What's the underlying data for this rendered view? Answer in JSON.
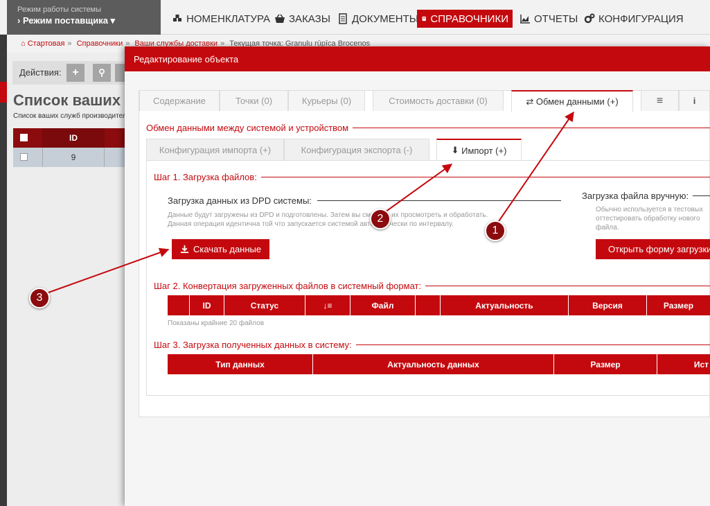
{
  "topbar": {
    "mode_caption": "Режим работы системы",
    "mode_value": "Режим поставщика",
    "nav": [
      {
        "label": "НОМЕНКЛАТУРА",
        "icon": "cubes-icon"
      },
      {
        "label": "ЗАКАЗЫ",
        "icon": "basket-icon"
      },
      {
        "label": "ДОКУМЕНТЫ",
        "icon": "document-icon"
      },
      {
        "label": "СПРАВОЧНИКИ",
        "icon": "book-icon",
        "active": true
      },
      {
        "label": "ОТЧЕТЫ",
        "icon": "chart-icon"
      },
      {
        "label": "КОНФИГУРАЦИЯ",
        "icon": "gears-icon"
      }
    ]
  },
  "breadcrumb": {
    "items": [
      "Стартовая",
      "Справочники",
      "Ваши службы доставки"
    ],
    "current": "Текущая точка: Granulu rūpīca Broceņos"
  },
  "background_page": {
    "actions_label": "Действия:",
    "title": "Список ваших служб доставки",
    "subtitle": "Список ваших служб производителя",
    "table_header_id": "ID",
    "row_id": "9"
  },
  "modal": {
    "title": "Редактирование объекта",
    "tabs": [
      "Содержание",
      "Точки (0)",
      "Курьеры (0)",
      "Стоимость доставки (0)",
      "Обмен данными (+)"
    ],
    "section_title": "Обмен данными между системой и устройством",
    "subtabs": [
      "Конфигурация импорта (+)",
      "Конфигурация экспорта (-)",
      "Импорт (+)"
    ],
    "step1": "Шаг 1. Загрузка файлов:",
    "dpd_title": "Загрузка данных из DPD системы:",
    "dpd_desc_1": "Данные будут загружены из DPD и подготовлены. Затем вы сможете их просмотреть и обработать.",
    "dpd_desc_2": "Данная операция идентична той что запускается системой автоматически по интервалу.",
    "download_button": "Скачать данные",
    "manual_title": "Загрузка файла вручную:",
    "manual_desc_1": "Обычно используется в тестовых",
    "manual_desc_2": "оттестировать обработку нового",
    "manual_desc_3": "файла.",
    "open_form_button": "Открыть форму загрузки",
    "step2": "Шаг 2. Конвертация загруженных файлов в системный формат:",
    "step2_columns": [
      "ID",
      "Статус",
      "Файл",
      "Актуальность",
      "Версия",
      "Размер"
    ],
    "step2_note": "Показаны крайние 20 файлов",
    "step3": "Шаг 3. Загрузка полученных данных в систему:",
    "step3_columns": [
      "Тип данных",
      "Актуальность данных",
      "Размер",
      "Ист"
    ]
  },
  "annotations": {
    "markers": [
      "1",
      "2",
      "3"
    ],
    "color": "#c4090e"
  },
  "colors": {
    "accent": "#c4090e",
    "dark_accent": "#8b0b0e"
  }
}
